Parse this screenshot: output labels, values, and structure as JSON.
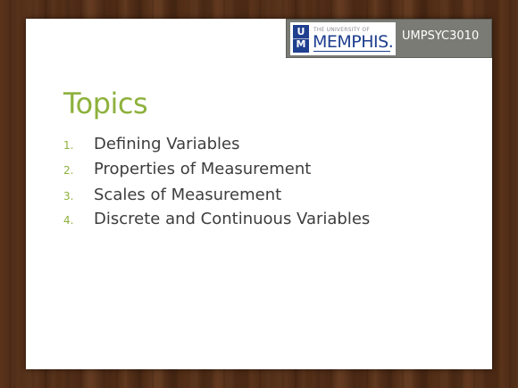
{
  "header": {
    "logo_small_text": "THE UNIVERSITY OF",
    "logo_big_text": "MEMPHIS.",
    "logo_mark_top": "U",
    "logo_mark_bottom": "M",
    "course_code": "UMPSYC3010"
  },
  "slide": {
    "title": "Topics",
    "topics": [
      {
        "number": "1.",
        "text": "Defining Variables"
      },
      {
        "number": "2.",
        "text": "Properties of Measurement"
      },
      {
        "number": "3.",
        "text": "Scales of Measurement"
      },
      {
        "number": "4.",
        "text": "Discrete and Continuous Variables"
      }
    ]
  },
  "colors": {
    "accent_green": "#8db13c",
    "brand_blue": "#1f3f8f",
    "header_gray": "#7a7b74",
    "body_text": "#3d3d3d"
  }
}
